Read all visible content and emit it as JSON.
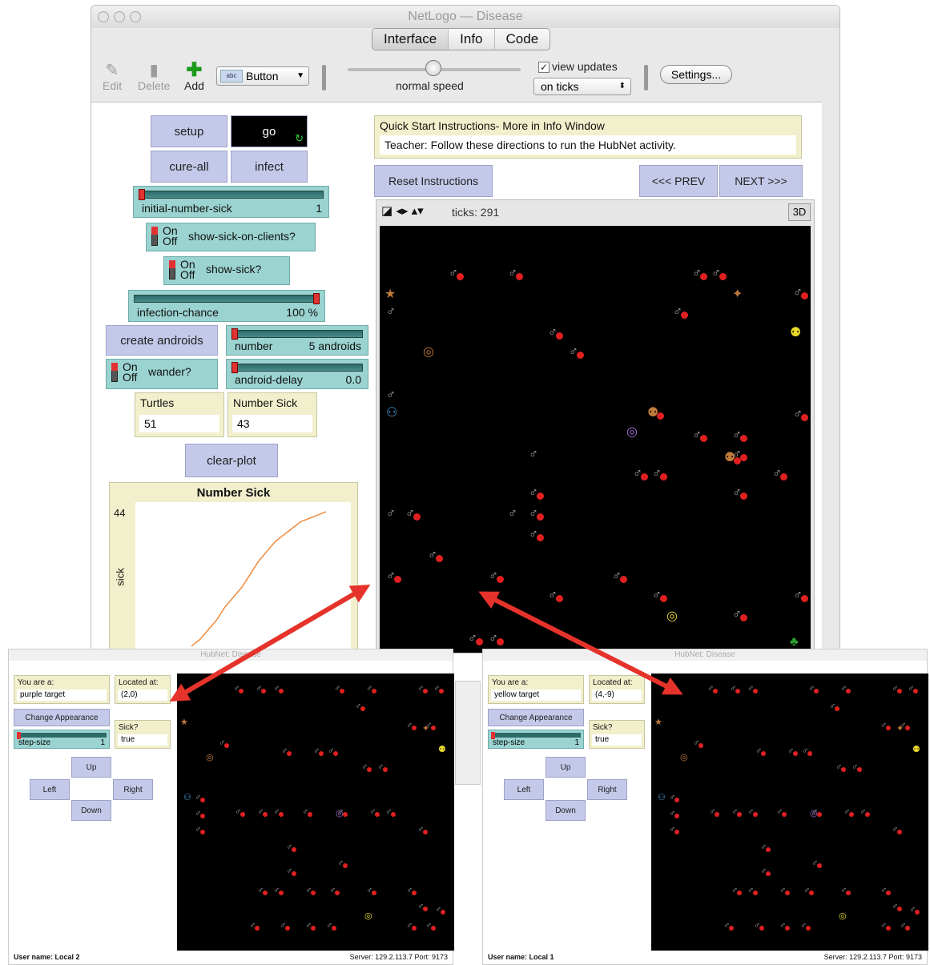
{
  "window": {
    "title": "NetLogo — Disease"
  },
  "tabs": [
    "Interface",
    "Info",
    "Code"
  ],
  "toolbar": {
    "edit": "Edit",
    "delete": "Delete",
    "add": "Add",
    "widget_type": "Button",
    "speed_label": "normal speed",
    "speed_fraction": 0.5,
    "view_updates_label": "view updates",
    "view_updates_checked": true,
    "update_mode": "on ticks",
    "settings": "Settings..."
  },
  "buttons": {
    "setup": "setup",
    "go": "go",
    "cure_all": "cure-all",
    "infect": "infect",
    "create_androids": "create androids",
    "clear_plot": "clear-plot",
    "reset_instructions": "Reset Instructions",
    "prev": "<<< PREV",
    "next": "NEXT >>>"
  },
  "sliders": {
    "initial_number_sick": {
      "name": "initial-number-sick",
      "value": "1",
      "fraction": 0.0
    },
    "infection_chance": {
      "name": "infection-chance",
      "value": "100 %",
      "fraction": 1.0
    },
    "number": {
      "name": "number",
      "value": "5 androids",
      "fraction": 0.0
    },
    "android_delay": {
      "name": "android-delay",
      "value": "0.0",
      "fraction": 0.0
    }
  },
  "switches": {
    "show_sick_on_clients": {
      "label": "show-sick-on-clients?",
      "on": "On",
      "off": "Off"
    },
    "show_sick": {
      "label": "show-sick?",
      "on": "On",
      "off": "Off"
    },
    "wander": {
      "label": "wander?",
      "on": "On",
      "off": "Off"
    }
  },
  "monitors": {
    "turtles": {
      "label": "Turtles",
      "value": "51"
    },
    "number_sick": {
      "label": "Number Sick",
      "value": "43"
    }
  },
  "notes": {
    "quick_start_title": "Quick Start Instructions- More in Info Window",
    "quick_start_text": "Teacher: Follow these directions to run the HubNet activity."
  },
  "plot": {
    "title": "Number Sick",
    "ylabel": "sick",
    "ymax": "44"
  },
  "chart_data": {
    "type": "line",
    "title": "Number Sick",
    "ylabel": "sick",
    "xlabel": "",
    "ylim": [
      0,
      44
    ],
    "series": [
      {
        "values": [
          2,
          4,
          7,
          10,
          14,
          17,
          20,
          24,
          28,
          31,
          34,
          36,
          38,
          40,
          41,
          42,
          43
        ]
      }
    ]
  },
  "view": {
    "ticks_label": "ticks: 291",
    "three_d": "3D"
  },
  "clients": [
    {
      "window_title": "HubNet: Disease",
      "you_are_label": "You are a:",
      "you_are_value": "purple target",
      "located_label": "Located at:",
      "located_value": "(2,0)",
      "change_appearance": "Change Appearance",
      "sick_label": "Sick?",
      "sick_value": "true",
      "step_size_name": "step-size",
      "step_size_value": "1",
      "up": "Up",
      "left": "Left",
      "right": "Right",
      "down": "Down",
      "user_name": "User name: Local 2",
      "server": "Server: 129.2.113.7  Port: 9173"
    },
    {
      "window_title": "HubNet: Disease",
      "you_are_label": "You are a:",
      "you_are_value": "yellow target",
      "located_label": "Located at:",
      "located_value": "(4,-9)",
      "change_appearance": "Change Appearance",
      "sick_label": "Sick?",
      "sick_value": "true",
      "step_size_name": "step-size",
      "step_size_value": "1",
      "up": "Up",
      "left": "Left",
      "right": "Right",
      "down": "Down",
      "user_name": "User name: Local 1",
      "server": "Server: 129.2.113.7  Port: 9173"
    }
  ],
  "colors": {
    "button": "#c4c9e9",
    "slider": "#9ad3d0",
    "monitor": "#f2f0cc",
    "sick": "#e02020",
    "arrow": "#e5322a",
    "plot_line": "#f08a3c"
  }
}
